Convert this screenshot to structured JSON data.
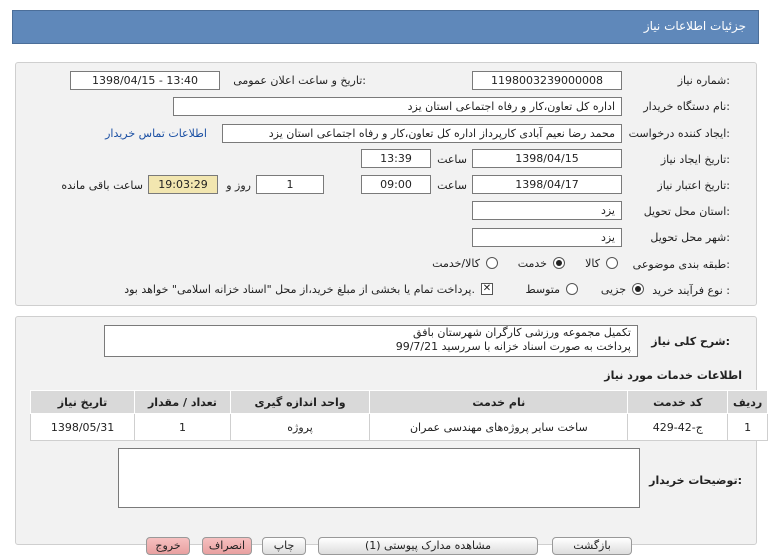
{
  "header": {
    "title": "جزئیات اطلاعات نیاز"
  },
  "form": {
    "need_number_label": "شماره نیاز:",
    "need_number": "1198003239000008",
    "announce_label": "تاریخ و ساعت اعلان عمومی:",
    "announce_value": "1398/04/15 - 13:40",
    "buyer_org_label": "نام دستگاه خریدار:",
    "buyer_org": "اداره کل تعاون،کار و رفاه اجتماعی استان یزد",
    "creator_label": "ایجاد کننده درخواست:",
    "creator": "محمد رضا  نعیم آبادی کارپرداز اداره کل تعاون،کار و رفاه اجتماعی استان یزد",
    "contact_link": "اطلاعات تماس خریدار",
    "created_date_label": "تاریخ ایجاد نیاز:",
    "created_date": "1398/04/15",
    "time_label": "ساعت",
    "created_time": "13:39",
    "validity_label": "تاریخ اعتبار نیاز:",
    "validity_date": "1398/04/17",
    "validity_time": "09:00",
    "days": "1",
    "days_label": "روز و",
    "remaining": "19:03:29",
    "remaining_label": "ساعت باقی مانده",
    "province_label": "استان محل تحویل:",
    "province": "یزد",
    "city_label": "شهر محل تحویل:",
    "city": "یزد",
    "category_label": "طبقه بندی موضوعی:",
    "category_options": [
      "کالا",
      "خدمت",
      "کالا/خدمت"
    ],
    "category_selected": "خدمت",
    "process_label": "نوع فرآیند خرید :",
    "process_options": [
      "جزیی",
      "متوسط"
    ],
    "process_selected": "جزیی",
    "payment_note": "پرداخت تمام یا بخشی از مبلغ خرید،از محل \"اسناد خزانه اسلامی\" خواهد بود."
  },
  "description": {
    "label": "شرح کلی نیاز:",
    "line1": "تکمیل مجموعه ورزشی کارگران شهرستان بافق",
    "line2": "پرداخت به صورت اسناد خزانه با سررسید 99/7/21"
  },
  "services": {
    "section_title": "اطلاعات خدمات مورد نیاز",
    "columns": [
      "ردیف",
      "کد خدمت",
      "نام خدمت",
      "واحد اندازه گیری",
      "تعداد / مقدار",
      "تاریخ نیاز"
    ],
    "rows": [
      [
        "1",
        "ج-42-429",
        "ساخت سایر پروژه‌های مهندسی عمران",
        "پروژه",
        "1",
        "1398/05/31"
      ]
    ]
  },
  "buyer_notes": {
    "label": "توضیحات خریدار:",
    "value": ""
  },
  "buttons": [
    "بازگشت",
    "مشاهده مدارک پیوستی (1)",
    "چاپ",
    "انصراف",
    "خروج"
  ],
  "colors": {
    "header_bg": "#5f88ba",
    "panel_bg": "#f2f2f2",
    "remaining_bg": "#f2e6b0"
  }
}
